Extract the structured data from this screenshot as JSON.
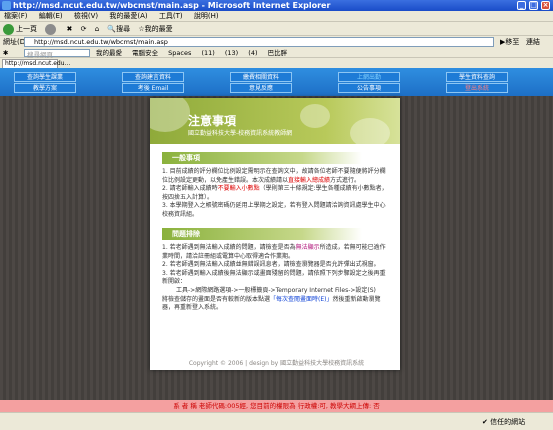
{
  "window": {
    "title": "http://msd.ncut.edu.tw/wbcmst/main.asp - Microsoft Internet Explorer"
  },
  "menu": [
    "檔案(F)",
    "編輯(E)",
    "檢視(V)",
    "我的最愛(A)",
    "工具(T)",
    "說明(H)"
  ],
  "toolbar": {
    "back": "上一頁",
    "search": "搜尋",
    "favorites": "我的最愛"
  },
  "address": {
    "label": "網址(D)",
    "url": "http://msd.ncut.edu.tw/wbcmst/main.asp",
    "go": "移至",
    "links": "連結"
  },
  "gtool": {
    "search_placeholder": "搜尋網頁",
    "items": [
      "我的最愛",
      "電腦安全",
      "Spaces",
      "(11)",
      "(13)",
      "(4)",
      "巴比胖"
    ]
  },
  "tab": {
    "label": "http://msd.ncut.edu..."
  },
  "nav": {
    "row1": [
      "查詢學生課業",
      "查詢建言資料",
      "繳費相關資料",
      "上網出勤",
      "學生資料查詢"
    ],
    "row2": [
      "教學方案",
      "考後 Email",
      "意見反應",
      "公告事項",
      "登出系統"
    ]
  },
  "notice": {
    "title": "注意事項",
    "subtitle": "國立勤益科技大學-校務資訊系統教師網",
    "sec1": "一般事項",
    "p1a": "1. 目前成績的評分欄位比例設定需明示在查詢文中，故請各位老師不要隨便將評分欄位比例設定更動，以免產生錯誤。本次成績請以",
    "p1r": "直接輸入總成績",
    "p1b": "方式進行。",
    "p2a": "2. 請老師輸入成績時",
    "p2r": "不要輸入小數點",
    "p2b": "（學則第三十條規定:學生各種成績有小數點者，按四捨五入計算）。",
    "p3": "3. 本學期登入之帳號密碼仍延用上學期之設定，若有登入問題請洽詢資訊處學生中心校務資訊組。",
    "sec2": "問題排除",
    "q1a": "1. 若老師遇到無法輸入成績的問題，請檢查是否為",
    "q1p": "無法顯示",
    "q1b": "所造成，若無可能已逾作業時間，請洽註冊組或電算中心取得適合作業期。",
    "q2": "2. 若老師遇到無法輸入成績並無錯誤訊息者，請檢查瀏覽器是否允許彈出式視窗。",
    "q3": "3. 若老師遇到輸入成績後無法顯示或畫面殘留的問題，請依照下列步驟設定之後再重新開啟：",
    "q4": "工具->網際網路選項->一般標籤頁->Temporary Internet Files->設定(S)",
    "q5a": "將檢查儲存的畫面是否有較新的版本點選",
    "q5b": "「每次查閱畫面時(E)」",
    "q5c": "然後重新啟動瀏覽器，再重新登入系統。"
  },
  "copyright": "Copyright © 2006 | design by 國立勤益科技大學校務資訊系統",
  "userbar": "系 者 稱  老師代碼:005經, 您目前的權限為 行政權:可, 教學大綱上傳: 否",
  "status": {
    "zone": "信任的網站"
  }
}
